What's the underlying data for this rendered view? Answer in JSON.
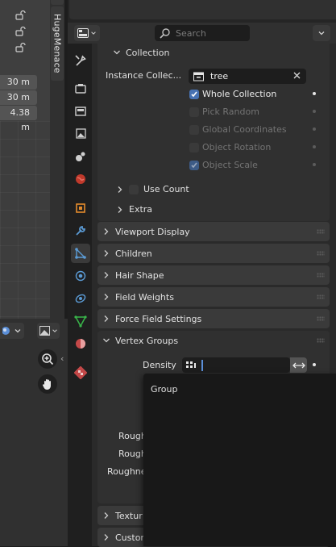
{
  "viewport": {
    "fields": [
      "30 m",
      "30 m",
      "4.38 m"
    ],
    "n_panel_tab": "HugeMenace",
    "icons": [
      "lock-icon",
      "lock-icon",
      "lock-icon"
    ]
  },
  "header": {
    "search_placeholder": "Search"
  },
  "collection_panel": {
    "title": "Collection",
    "instance_label": "Instance Collec...",
    "instance_value": "tree",
    "options": [
      {
        "label": "Whole Collection",
        "checked": true,
        "enabled": true
      },
      {
        "label": "Pick Random",
        "checked": false,
        "enabled": false
      },
      {
        "label": "Global Coordinates",
        "checked": false,
        "enabled": false
      },
      {
        "label": "Object Rotation",
        "checked": false,
        "enabled": false
      },
      {
        "label": "Object Scale",
        "checked": true,
        "enabled": false
      }
    ],
    "use_count": "Use Count",
    "extra": "Extra"
  },
  "panels": [
    "Viewport Display",
    "Children",
    "Hair Shape",
    "Field Weights",
    "Force Field Settings",
    "Vertex Groups"
  ],
  "vertex_groups": {
    "density_label": "Density",
    "partial_labels": [
      "Rough",
      "Rough",
      "Roughne"
    ]
  },
  "popup": {
    "title": "Group"
  },
  "bottom_panels": [
    "Textur",
    "Custon"
  ],
  "colors": {
    "accent": "#4772b3",
    "panel": "#3a3a3a",
    "background": "#2a2a2a"
  }
}
